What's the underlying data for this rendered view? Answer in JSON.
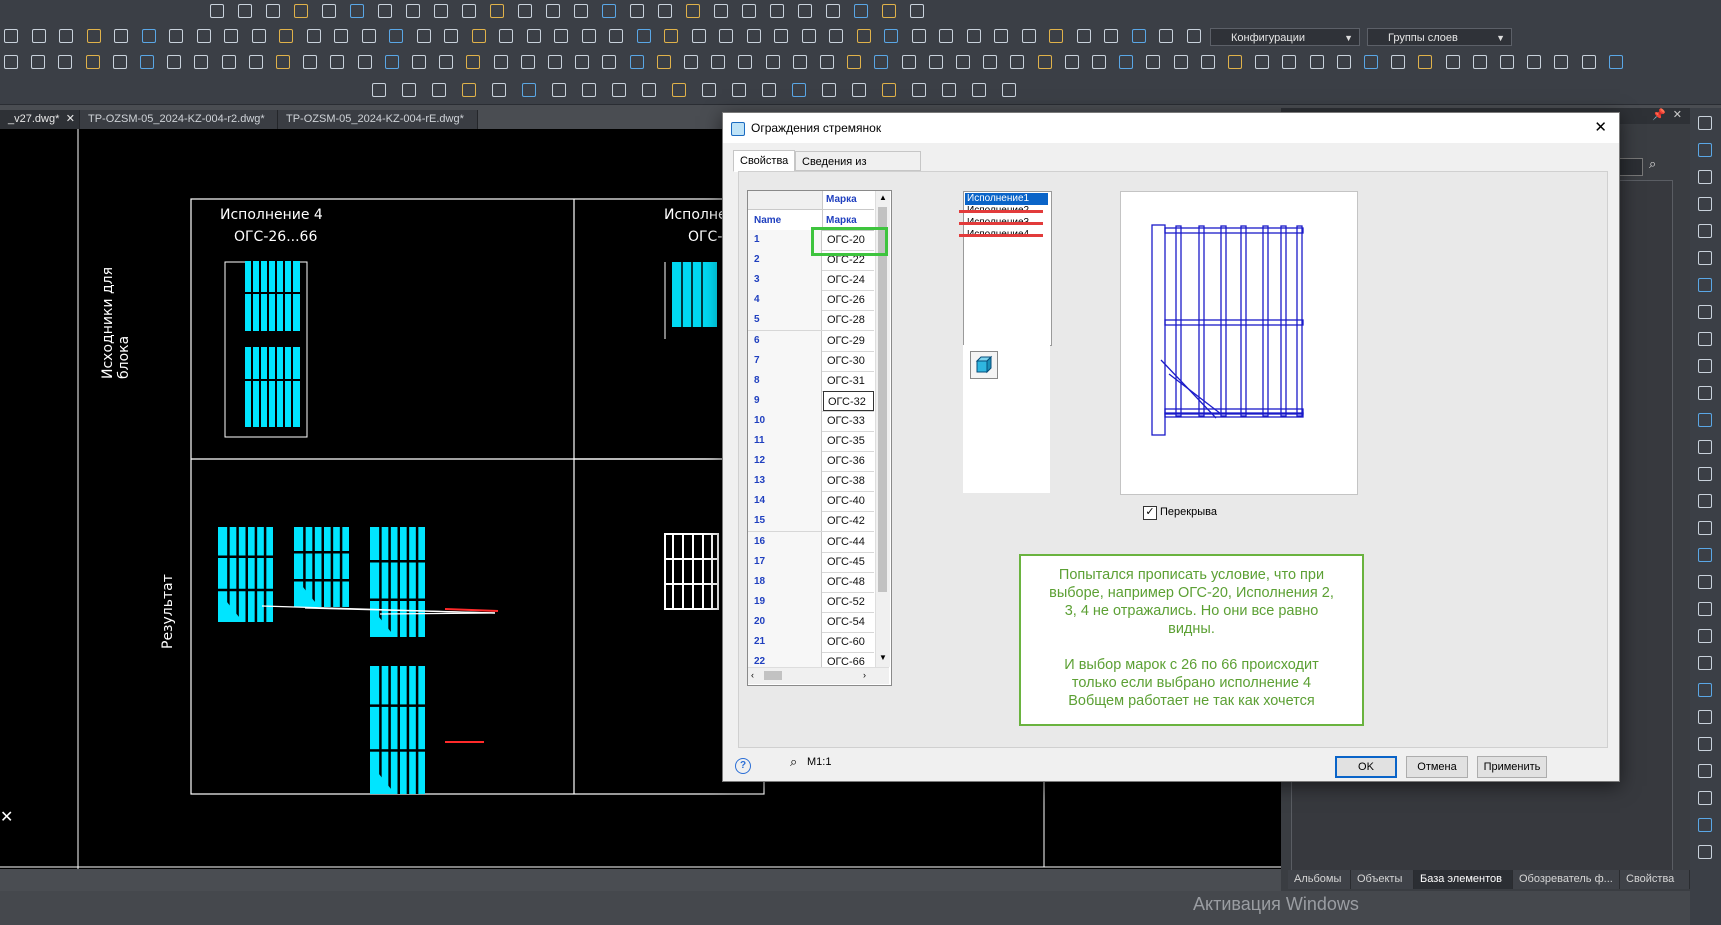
{
  "doc_tabs": [
    "_v27.dwg*",
    "TP-OZSM-05_2024-KZ-004-r2.dwg*",
    "TP-OZSM-05_2024-KZ-004-rE.dwg*"
  ],
  "toolbar": {
    "config_combo": "Конфигурации",
    "layer_groups_combo": "Группы слоев"
  },
  "drawing": {
    "variant4_title": "Исполнение 4",
    "variant4_range": "ОГС-26...66",
    "variant_next_title": "Исполнен",
    "variant_next_range": "ОГС-2",
    "side_label_top": "Исходники для блока",
    "side_label_bottom": "Результат"
  },
  "dialog": {
    "title": "Ограждения стремянок",
    "tabs": [
      "Свойства",
      "Сведения из NormaCS"
    ],
    "grid": {
      "header_col": "Марка",
      "name_col": "Name",
      "value_col": "Марка",
      "rows": [
        {
          "n": "1",
          "v": "ОГС-20"
        },
        {
          "n": "2",
          "v": "ОГС-22"
        },
        {
          "n": "3",
          "v": "ОГС-24"
        },
        {
          "n": "4",
          "v": "ОГС-26"
        },
        {
          "n": "5",
          "v": "ОГС-28"
        },
        {
          "n": "6",
          "v": "ОГС-29"
        },
        {
          "n": "7",
          "v": "ОГС-30"
        },
        {
          "n": "8",
          "v": "ОГС-31"
        },
        {
          "n": "9",
          "v": "ОГС-32"
        },
        {
          "n": "10",
          "v": "ОГС-33"
        },
        {
          "n": "11",
          "v": "ОГС-35"
        },
        {
          "n": "12",
          "v": "ОГС-36"
        },
        {
          "n": "13",
          "v": "ОГС-38"
        },
        {
          "n": "14",
          "v": "ОГС-40"
        },
        {
          "n": "15",
          "v": "ОГС-42"
        },
        {
          "n": "16",
          "v": "ОГС-44"
        },
        {
          "n": "17",
          "v": "ОГС-45"
        },
        {
          "n": "18",
          "v": "ОГС-48"
        },
        {
          "n": "19",
          "v": "ОГС-52"
        },
        {
          "n": "20",
          "v": "ОГС-54"
        },
        {
          "n": "21",
          "v": "ОГС-60"
        },
        {
          "n": "22",
          "v": "ОГС-66"
        }
      ]
    },
    "variants": [
      "Исполнение1",
      "Исполнение2",
      "Исполнение3",
      "Исполнение4"
    ],
    "checkbox_label": "Перекрыва",
    "checkbox_checked": true,
    "scale_label": "М1:1",
    "buttons": {
      "ok": "OK",
      "cancel": "Отмена",
      "apply": "Применить"
    },
    "note_lines": [
      "Попытался прописать условие, что при",
      "выборе, например ОГС-20, Исполнения 2,",
      "3, 4 не отражались. Но они все равно",
      "видны.",
      "",
      "И выбор марок с 26 по 66 происходит",
      "только если выбрано исполнение 4",
      "Вобщем работает не так как хочется"
    ]
  },
  "right_panel_tabs": [
    "Альбомы",
    "Объекты",
    "База элементов",
    "Обозреватель ф...",
    "Свойства"
  ],
  "watermark": "Активация Windows",
  "colors": {
    "cad_cyan": "#00e5ff",
    "highlight_green": "#3ec43e",
    "strike_red": "#e23b3b",
    "note_green": "#5ca034"
  }
}
